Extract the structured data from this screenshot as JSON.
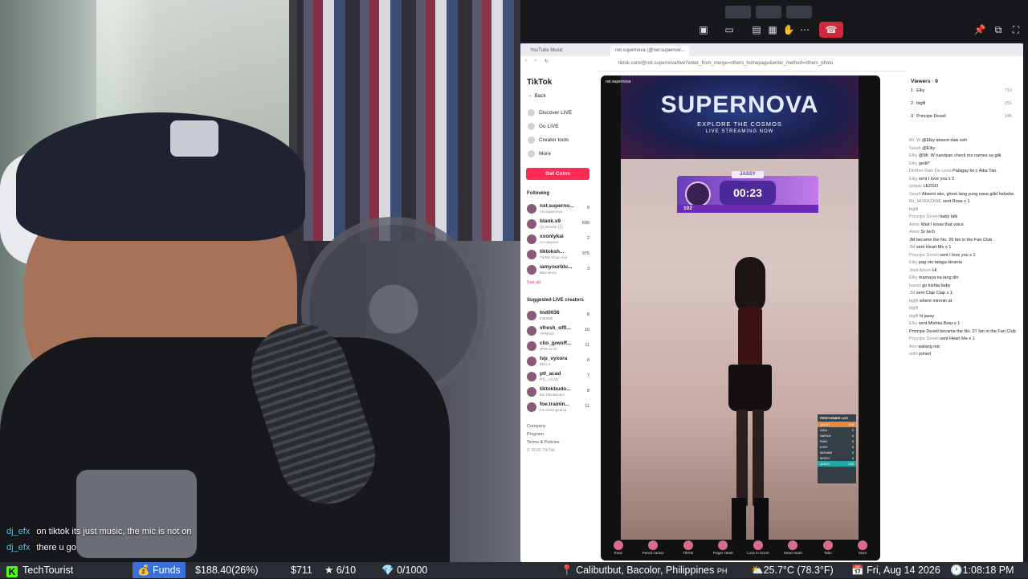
{
  "topbar": {
    "icons": [
      "camera-icon",
      "screen-share-icon",
      "chat-icon",
      "grid-icon",
      "hand-icon",
      "more-icon",
      "end-call-icon",
      "pin-icon",
      "popout-icon",
      "fullscreen-icon"
    ]
  },
  "browser": {
    "tab1": "YouTube Music",
    "tab2": "nxt.supernova (@nxt.supernov...",
    "url": "tiktok.com/@nxt.supernova/live?enter_from_merge=others_homepage&enter_method=others_photo"
  },
  "tiktok": {
    "logo": "TikTok",
    "back": "Back",
    "nav": [
      "Discover LIVE",
      "Go LIVE",
      "Creator tools",
      "More"
    ],
    "get_coins": "Get Coins",
    "following_header": "Following",
    "following": [
      {
        "name": "nxt.superno...",
        "sub": "nxt.supernova",
        "count": "9"
      },
      {
        "name": "blank.s9",
        "sub": "(((( BLVNK ))))",
        "count": "690"
      },
      {
        "name": "xxonlykai",
        "sub": "xo-carpione",
        "count": "2"
      },
      {
        "name": "tiktoksh...",
        "sub": "TikTok Shop Live",
        "count": "975"
      },
      {
        "name": "iamyourblu...",
        "sub": "Blue Berry",
        "count": "3"
      }
    ],
    "see_all": "See all",
    "suggested_header": "Suggested LIVE creators",
    "suggested": [
      {
        "name": "tnd0036",
        "sub": "tnd0036",
        "count": "8"
      },
      {
        "name": "vfresh_offi...",
        "sub": "VFRESH",
        "count": "10"
      },
      {
        "name": "clio_jpwoff...",
        "sub": "JPW-CLIO",
        "count": "11"
      },
      {
        "name": "tvp_vyxora",
        "sub": "ZELLA",
        "count": "8"
      },
      {
        "name": "ptl_acad",
        "sub": "PTL_ACAD",
        "count": "7"
      },
      {
        "name": "tiktokbudo...",
        "sub": "Ms.TiktokBudol",
        "count": "8"
      },
      {
        "name": "foe.trainin...",
        "sub": "foe.trainingcamp",
        "count": "11"
      }
    ],
    "footer": [
      "Company",
      "Program",
      "Terms & Policies",
      "© 2026 TikTok"
    ]
  },
  "live": {
    "host": "nxt.supernova",
    "banner_title": "SUPERNOVA",
    "banner_line1": "EXPLORE THE COSMOS",
    "banner_line2": "LIVE STREAMING NOW",
    "contestant": "JASSY",
    "timer": "00:23",
    "score": "102",
    "performer_list_title": "PERFORMER LIST",
    "performers": [
      {
        "name": "JASSY",
        "score": "102"
      },
      {
        "name": "AIKA",
        "score": "0"
      },
      {
        "name": "SARAH",
        "score": "0"
      },
      {
        "name": "RAM",
        "score": "0"
      },
      {
        "name": "KISH",
        "score": "0"
      },
      {
        "name": "MIRABE",
        "score": "0"
      },
      {
        "name": "MISSY",
        "score": "0"
      },
      {
        "name": "JASSY",
        "score": "102"
      }
    ],
    "gifts": [
      "Rose",
      "Pancit canton",
      "TikTok",
      "Finger Heart",
      "Love in Scent",
      "Hand Heart",
      "Taho",
      "More"
    ]
  },
  "chat": {
    "viewers_label": "Viewers",
    "viewers_count": "9",
    "top_viewers": [
      {
        "rank": "1",
        "name": "Elky",
        "score": "710"
      },
      {
        "rank": "2",
        "name": "bigfil",
        "score": "251"
      },
      {
        "rank": "3",
        "name": "Principe Dexell",
        "score": "145"
      }
    ],
    "messages": [
      {
        "u": "Mr. W",
        "t": "@Elky absent daw eeh"
      },
      {
        "u": "Sarah",
        "t": "@Elky"
      },
      {
        "u": "Elky",
        "t": "@Mr. W nandyan check mo names sa gilii"
      },
      {
        "u": "Elky",
        "t": "gedil*"
      },
      {
        "u": "Dinther Dais De Leon",
        "t": "Palagay ko c Aika Yan."
      },
      {
        "u": "Elky",
        "t": "sent I love you x 5"
      },
      {
        "u": "yelaay",
        "t": "LEZGO"
      },
      {
        "u": "Sarah",
        "t": "Absent ako, ghost lang yung nasa gilid hahaha"
      },
      {
        "u": "Mr_MOBAZANE",
        "t": "sent Rose x 1"
      },
      {
        "u": "bigfil",
        "t": ""
      },
      {
        "u": "Principe Dexell",
        "t": "baby talk"
      },
      {
        "u": "Amor",
        "t": "Wait I know that voice"
      },
      {
        "u": "Amor",
        "t": "Sr tech"
      },
      {
        "u": "",
        "t": "JM became the No. 26 fan in the Fan Club"
      },
      {
        "u": "JM",
        "t": "sent Heart Me x 1"
      },
      {
        "u": "Principe Dexell",
        "t": "sent I love you x 1"
      },
      {
        "u": "Elky",
        "t": "pag oto talaga kinanta"
      },
      {
        "u": "Josit Arturo",
        "t": "Hi"
      },
      {
        "u": "Elky",
        "t": "mamaya na lang din"
      },
      {
        "u": "Ivanbi",
        "t": "go kishia baby"
      },
      {
        "u": "JM",
        "t": "sent Clap Clap x 1"
      },
      {
        "u": "bigfil",
        "t": "where minmin at"
      },
      {
        "u": "bigfil",
        "t": ""
      },
      {
        "u": "bigfil",
        "t": "hi jassy"
      },
      {
        "u": "Elky",
        "t": "sent Mishka Bear x 1"
      },
      {
        "u": "",
        "t": "Principe Dexell became the No. 27 fan in the Fan Club"
      },
      {
        "u": "Principe Dexell",
        "t": "sent Heart Me x 1"
      },
      {
        "u": "Ann",
        "t": "walang mic"
      },
      {
        "u": "eidrt",
        "t": "joined"
      }
    ]
  },
  "overlay_chat": [
    {
      "user": "dj_efx",
      "text": "on tiktok its just music, the mic is not on"
    },
    {
      "user": "dj_efx",
      "text": "there u go"
    }
  ],
  "statusbar": {
    "channel_icon": "K",
    "channel": "TechTourist",
    "funds_label": "Funds",
    "funds_value": "$188.40(26%)",
    "money": "$711",
    "stars": "6/10",
    "gems": "0/1000",
    "location": "Calibutbut, Bacolor, Philippines",
    "location_code": "PH",
    "weather": "25.7°C (78.3°F)",
    "date": "Fri, Aug 14 2026",
    "time": "1:08:18 PM"
  }
}
